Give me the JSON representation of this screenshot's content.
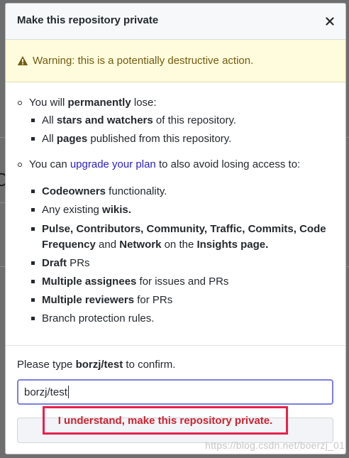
{
  "dialog": {
    "title": "Make this repository private",
    "close_icon": "close-icon",
    "warning": {
      "icon": "alert-icon",
      "text": "Warning: this is a potentially destructive action."
    },
    "lose": {
      "prefix": "You will ",
      "bold": "permanently",
      "suffix": " lose:",
      "items": [
        {
          "pre": "All ",
          "bold": "stars and watchers",
          "post": " of this repository."
        },
        {
          "pre": "All ",
          "bold": "pages",
          "post": " published from this repository."
        }
      ]
    },
    "upgrade": {
      "prefix": "You can ",
      "link": "upgrade your plan",
      "suffix": " to also avoid losing access to:",
      "items": {
        "codeowners_bold": "Codeowners",
        "codeowners_post": " functionality.",
        "wikis_pre": "Any existing ",
        "wikis_bold": "wikis.",
        "insights_bold1": "Pulse, Contributors, Community, Traffic, Commits, Code Frequency",
        "insights_and": " and ",
        "insights_bold2": "Network",
        "insights_on": " on the ",
        "insights_bold3": "Insights page.",
        "draft_bold": "Draft",
        "draft_post": " PRs",
        "assignees_bold": "Multiple assignees",
        "assignees_post": " for issues and PRs",
        "reviewers_bold": "Multiple reviewers",
        "reviewers_post": " for PRs",
        "branch": "Branch protection rules."
      }
    },
    "confirm": {
      "pre": "Please type ",
      "bold": "borzj/test",
      "post": " to confirm.",
      "input_value": "borzj/test",
      "button_label": "I understand, make this repository private."
    }
  },
  "watermark": "https://blog.csdn.net/boerzj_01",
  "colors": {
    "danger": "#cb2431",
    "highlight": "#e8214d",
    "link": "#2a1ec8",
    "warning_bg": "#fffbdd"
  }
}
